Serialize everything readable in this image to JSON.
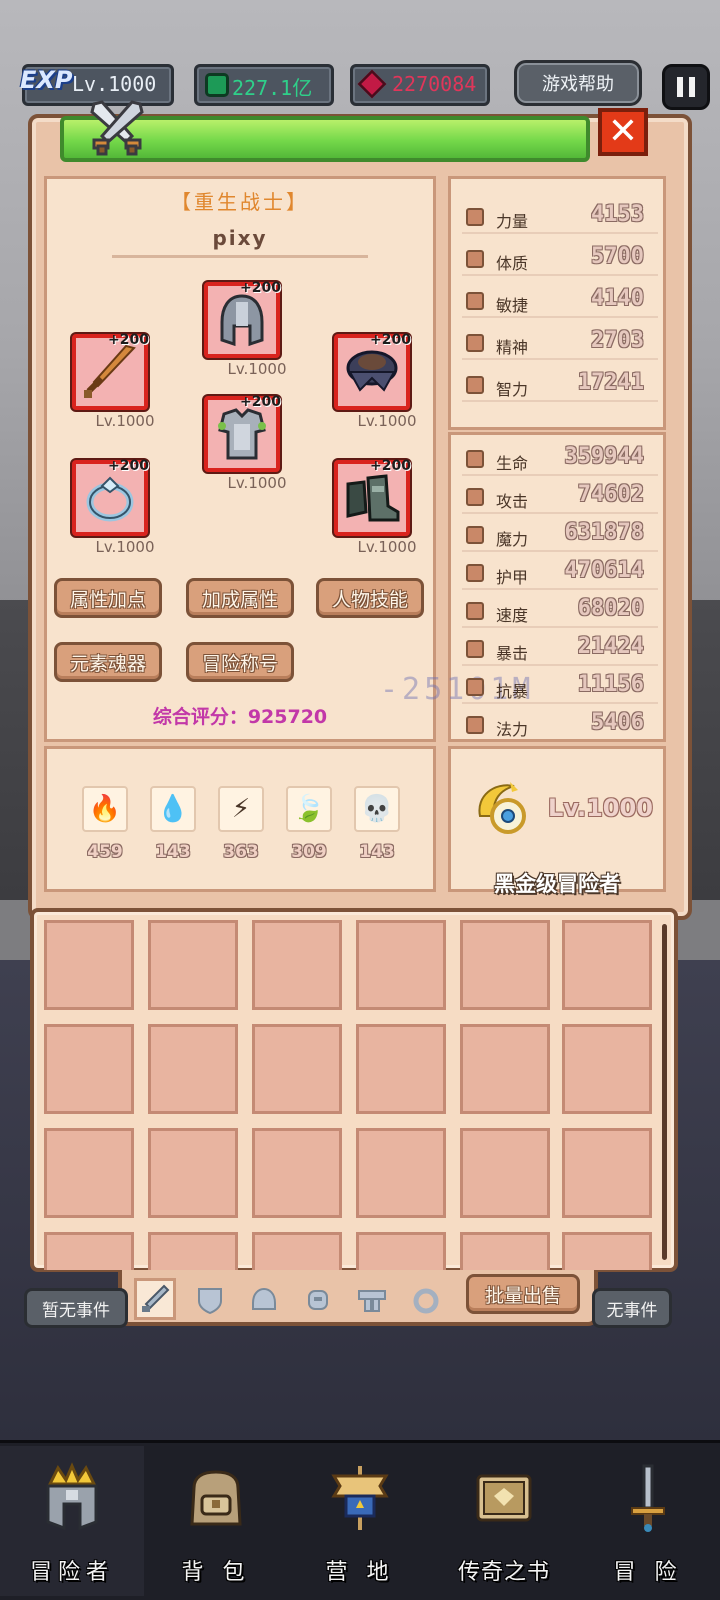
{
  "hud": {
    "exp_badge": "EXP",
    "exp_level": "Lv.1000",
    "gem_value": "227.1亿",
    "ruby_value": "2270084",
    "help_label": "游戏帮助"
  },
  "character": {
    "class_title": "【重生战士】",
    "name": "pixy",
    "score_label": "综合评分：925720",
    "damage_floater": "-25101M"
  },
  "equipment": [
    {
      "slot": "helmet",
      "plus": "+200",
      "level": "Lv.1000"
    },
    {
      "slot": "weapon",
      "plus": "+200",
      "level": "Lv.1000"
    },
    {
      "slot": "shoulder",
      "plus": "+200",
      "level": "Lv.1000"
    },
    {
      "slot": "armor",
      "plus": "+200",
      "level": "Lv.1000"
    },
    {
      "slot": "ring",
      "plus": "+200",
      "level": "Lv.1000"
    },
    {
      "slot": "boots",
      "plus": "+200",
      "level": "Lv.1000"
    }
  ],
  "actions": {
    "attr_points": "属性加点",
    "bonus_attrs": "加成属性",
    "skills": "人物技能",
    "soul_gear": "元素魂器",
    "titles": "冒险称号"
  },
  "base_stats": [
    {
      "label": "力量",
      "value": "4153",
      "icon": "strength-icon"
    },
    {
      "label": "体质",
      "value": "5700",
      "icon": "heart-icon"
    },
    {
      "label": "敏捷",
      "value": "4140",
      "icon": "boot-icon"
    },
    {
      "label": "精神",
      "value": "2703",
      "icon": "star-icon"
    },
    {
      "label": "智力",
      "value": "17241",
      "icon": "brain-icon"
    }
  ],
  "combat_stats": [
    {
      "label": "生命",
      "value": "359944",
      "icon": "heart-icon"
    },
    {
      "label": "攻击",
      "value": "74602",
      "icon": "sword-icon"
    },
    {
      "label": "魔力",
      "value": "631878",
      "icon": "staff-icon"
    },
    {
      "label": "护甲",
      "value": "470614",
      "icon": "shield-icon"
    },
    {
      "label": "速度",
      "value": "68020",
      "icon": "boot-icon"
    },
    {
      "label": "暴击",
      "value": "21424",
      "icon": "crit-icon"
    },
    {
      "label": "抗暴",
      "value": "11156",
      "icon": "crit-resist-icon"
    },
    {
      "label": "法力",
      "value": "5406",
      "icon": "star-icon"
    }
  ],
  "elements": [
    {
      "name": "fire",
      "count": "459",
      "glyph": "🔥",
      "color": "#e8451e"
    },
    {
      "name": "water",
      "count": "143",
      "glyph": "💧",
      "color": "#3a8ee8"
    },
    {
      "name": "lightning",
      "count": "363",
      "glyph": "⚡",
      "color": "#f0a020"
    },
    {
      "name": "wind",
      "count": "309",
      "glyph": "🍃",
      "color": "#2fb04a"
    },
    {
      "name": "dark",
      "count": "143",
      "glyph": "💀",
      "color": "#7a5a52"
    }
  ],
  "rank": {
    "level": "Lv.1000",
    "title": "黑金级冒险者"
  },
  "inventory": {
    "bulk_sell": "批量出售",
    "tabs": [
      "weapon",
      "armor",
      "helmet",
      "shoulder",
      "belt",
      "ring"
    ]
  },
  "events": {
    "left": "暂无事件",
    "right": "无事件"
  },
  "nav": {
    "adventurer": "冒险者",
    "backpack": "背 包",
    "camp": "营 地",
    "legend_book": "传奇之书",
    "adventure": "冒 险"
  },
  "colors": {
    "panel_bg": "#e9c3a8",
    "panel_border": "#7c5238",
    "slot_border": "#d9231e",
    "score_color": "#c238a8",
    "class_color": "#e0872e"
  }
}
